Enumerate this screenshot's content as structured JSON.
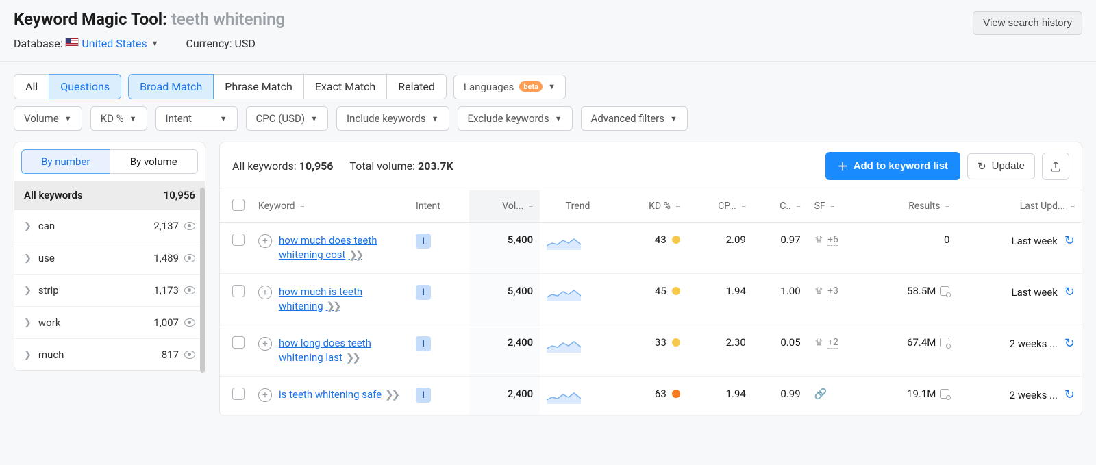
{
  "header": {
    "title_prefix": "Keyword Magic Tool:",
    "search_term": "teeth whitening",
    "database_label": "Database:",
    "database_value": "United States",
    "currency_label": "Currency: USD",
    "view_history": "View search history"
  },
  "match_tabs": {
    "all": "All",
    "questions": "Questions",
    "broad": "Broad Match",
    "phrase": "Phrase Match",
    "exact": "Exact Match",
    "related": "Related"
  },
  "languages": {
    "label": "Languages",
    "badge": "beta"
  },
  "filters": {
    "volume": "Volume",
    "kd": "KD %",
    "intent": "Intent",
    "cpc": "CPC (USD)",
    "include": "Include keywords",
    "exclude": "Exclude keywords",
    "advanced": "Advanced filters"
  },
  "sidebar": {
    "tab_number": "By number",
    "tab_volume": "By volume",
    "all_label": "All keywords",
    "all_count": "10,956",
    "groups": [
      {
        "name": "can",
        "count": "2,137"
      },
      {
        "name": "use",
        "count": "1,489"
      },
      {
        "name": "strip",
        "count": "1,173"
      },
      {
        "name": "work",
        "count": "1,007"
      },
      {
        "name": "much",
        "count": "817"
      }
    ]
  },
  "summary": {
    "all_kw_label": "All keywords:",
    "all_kw_value": "10,956",
    "total_vol_label": "Total volume:",
    "total_vol_value": "203.7K",
    "add_list": "Add to keyword list",
    "update": "Update"
  },
  "columns": {
    "keyword": "Keyword",
    "intent": "Intent",
    "volume": "Vol...",
    "trend": "Trend",
    "kd": "KD %",
    "cpc": "CP...",
    "com": "C..",
    "sf": "SF",
    "results": "Results",
    "last_upd": "Last Upd..."
  },
  "rows": [
    {
      "keyword": "how much does teeth whitening cost",
      "intent": "I",
      "volume": "5,400",
      "kd": "43",
      "kd_color": "yellow",
      "cpc": "2.09",
      "com": "0.97",
      "sf_icon": "crown",
      "sf_plus": "+6",
      "results": "0",
      "last_upd": "Last week"
    },
    {
      "keyword": "how much is teeth whitening",
      "intent": "I",
      "volume": "5,400",
      "kd": "45",
      "kd_color": "yellow",
      "cpc": "1.94",
      "com": "1.00",
      "sf_icon": "crown",
      "sf_plus": "+3",
      "results": "58.5M",
      "last_upd": "Last week"
    },
    {
      "keyword": "how long does teeth whitening last",
      "intent": "I",
      "volume": "2,400",
      "kd": "33",
      "kd_color": "yellow",
      "cpc": "2.30",
      "com": "0.05",
      "sf_icon": "crown",
      "sf_plus": "+2",
      "results": "67.4M",
      "last_upd": "2 weeks ..."
    },
    {
      "keyword": "is teeth whitening safe",
      "intent": "I",
      "volume": "2,400",
      "kd": "63",
      "kd_color": "orange",
      "cpc": "1.94",
      "com": "0.99",
      "sf_icon": "link",
      "sf_plus": "",
      "results": "19.1M",
      "last_upd": "2 weeks ..."
    }
  ]
}
